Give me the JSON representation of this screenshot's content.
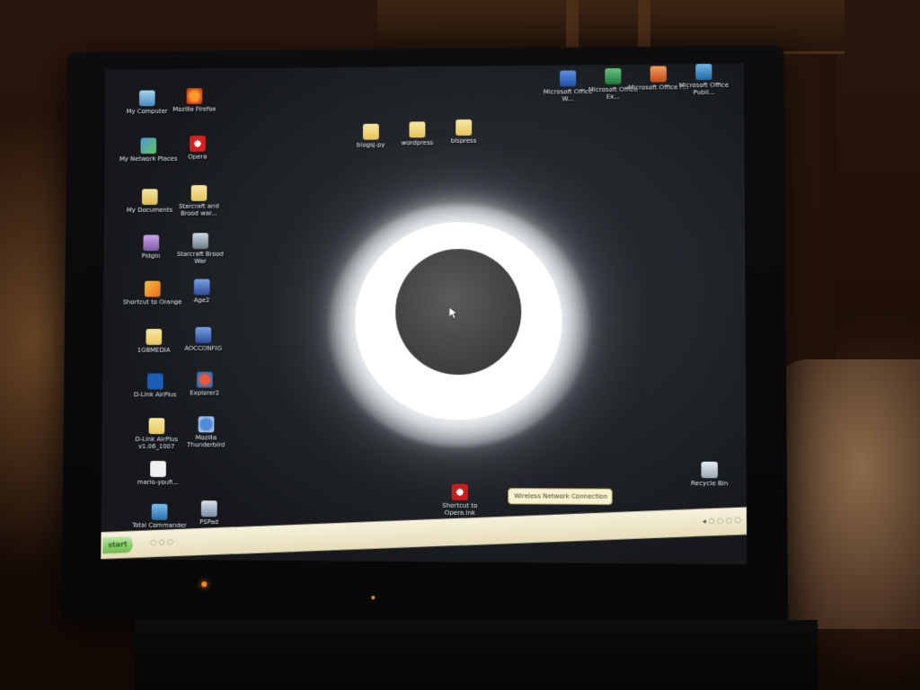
{
  "desktop": {
    "left_icons": [
      {
        "label": "My Computer",
        "icon": "my-computer-icon"
      },
      {
        "label": "Mozilla Firefox",
        "icon": "firefox-icon"
      },
      {
        "label": "My Network Places",
        "icon": "network-places-icon"
      },
      {
        "label": "Opera",
        "icon": "opera-icon"
      },
      {
        "label": "My Documents",
        "icon": "my-documents-icon"
      },
      {
        "label": "Starcraft and Brood war...",
        "icon": "folder-icon"
      },
      {
        "label": "Pidgin",
        "icon": "pidgin-icon"
      },
      {
        "label": "Starcraft Brood War",
        "icon": "starcraft-icon"
      },
      {
        "label": "Shortcut to Orange",
        "icon": "shortcut-icon"
      },
      {
        "label": "Age2",
        "icon": "age-of-empires-icon"
      },
      {
        "label": "1GBMEDIA",
        "icon": "folder-icon"
      },
      {
        "label": "AOCCONFIG",
        "icon": "config-icon"
      },
      {
        "label": "D-Link AirPlus",
        "icon": "dlink-icon"
      },
      {
        "label": "Explorer2",
        "icon": "explorer-icon"
      },
      {
        "label": "D-Link AirPlus v1.06_1007",
        "icon": "folder-icon"
      },
      {
        "label": "Mozilla Thunderbird",
        "icon": "thunderbird-icon"
      },
      {
        "label": "mario-youfi...",
        "icon": "document-icon"
      },
      {
        "label": "Total Commander",
        "icon": "total-commander-icon"
      },
      {
        "label": "PSPad",
        "icon": "pspad-icon"
      }
    ],
    "center_folders": [
      {
        "label": "blogsj-py"
      },
      {
        "label": "wordpress"
      },
      {
        "label": "blspress"
      }
    ],
    "top_right_icons": [
      {
        "label": "Microsoft Office W...",
        "icon": "word-icon"
      },
      {
        "label": "Microsoft Office Ex...",
        "icon": "excel-icon"
      },
      {
        "label": "Microsoft Office P...",
        "icon": "powerpoint-icon"
      },
      {
        "label": "Microsoft Office Publi...",
        "icon": "publisher-icon"
      }
    ],
    "bottom_icons": [
      {
        "label": "Shortcut to Opera.lnk",
        "icon": "opera-shortcut-icon"
      },
      {
        "label": "Recycle Bin",
        "icon": "recycle-bin-icon"
      }
    ],
    "balloon_text": "Wireless Network Connection",
    "wallpaper": "total solar eclipse"
  },
  "taskbar": {
    "start_label": "start",
    "quicklaunch_text": "◌ ◌ ◌",
    "tray_text": "◂ ◌ ◌ ◌ ◌"
  },
  "colors": {
    "taskbar": "#efe8c8",
    "start_button": "#6fb94e",
    "desktop": "#22262b",
    "bezel": "#0d0d0f"
  }
}
